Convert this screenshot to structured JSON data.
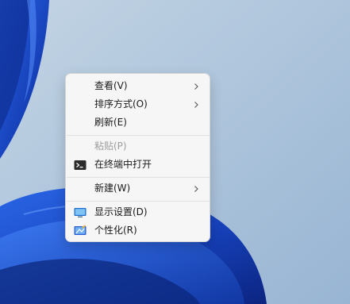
{
  "colors": {
    "desktop_sky": "#a7c0d8",
    "wallpaper_blue": "#1a45c8",
    "menu_background": "#f6f6f6",
    "disabled_text": "#9c9c9c"
  },
  "context_menu": {
    "items": [
      {
        "label": "查看(V)",
        "submenu": true,
        "icon": null,
        "enabled": true
      },
      {
        "label": "排序方式(O)",
        "submenu": true,
        "icon": null,
        "enabled": true
      },
      {
        "label": "刷新(E)",
        "submenu": false,
        "icon": null,
        "enabled": true
      },
      {
        "label": "粘贴(P)",
        "submenu": false,
        "icon": null,
        "enabled": false
      },
      {
        "label": "在终端中打开",
        "submenu": false,
        "icon": "terminal-icon",
        "enabled": true
      },
      {
        "label": "新建(W)",
        "submenu": true,
        "icon": null,
        "enabled": true
      },
      {
        "label": "显示设置(D)",
        "submenu": false,
        "icon": "display-settings-icon",
        "enabled": true
      },
      {
        "label": "个性化(R)",
        "submenu": false,
        "icon": "personalize-icon",
        "enabled": true
      }
    ]
  }
}
